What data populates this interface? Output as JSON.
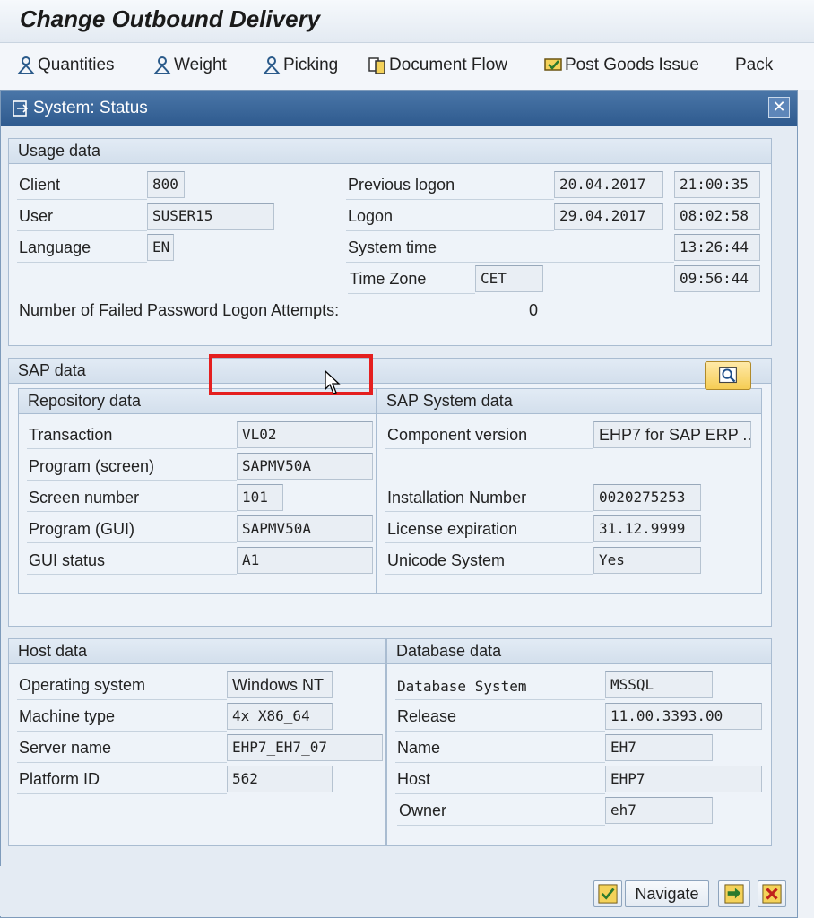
{
  "app": {
    "title": "Change Outbound Delivery"
  },
  "toolbar": {
    "quantities": "Quantities",
    "weight": "Weight",
    "picking": "Picking",
    "document_flow": "Document Flow",
    "post_goods_issue": "Post Goods Issue",
    "pack": "Pack"
  },
  "dialog": {
    "title": "System: Status",
    "close": "✕"
  },
  "usage": {
    "header": "Usage data",
    "client_label": "Client",
    "client": "800",
    "user_label": "User",
    "user": "SUSER15",
    "language_label": "Language",
    "language": "EN",
    "prev_logon_label": "Previous logon",
    "prev_logon_date": "20.04.2017",
    "prev_logon_time": "21:00:35",
    "logon_label": "Logon",
    "logon_date": "29.04.2017",
    "logon_time": "08:02:58",
    "system_time_label": "System time",
    "system_time": "13:26:44",
    "time_zone_label": "Time Zone",
    "time_zone": "CET",
    "time_zone_time": "09:56:44",
    "failed_label": "Number of Failed Password Logon Attempts:",
    "failed": "0"
  },
  "sap": {
    "header": "SAP data",
    "repo_header": "Repository data",
    "transaction_label": "Transaction",
    "transaction": "VL02",
    "program_screen_label": "Program (screen)",
    "program_screen": "SAPMV50A",
    "screen_number_label": "Screen number",
    "screen_number": "101",
    "program_gui_label": "Program (GUI)",
    "program_gui": "SAPMV50A",
    "gui_status_label": "GUI status",
    "gui_status": "A1",
    "system_header": "SAP System data",
    "component_label": "Component version",
    "component": "EHP7 for SAP ERP ...",
    "installation_label": "Installation Number",
    "installation": "0020275253",
    "license_label": "License expiration",
    "license": "31.12.9999",
    "unicode_label": "Unicode System",
    "unicode": "Yes"
  },
  "host": {
    "header": "Host data",
    "os_label": "Operating system",
    "os": "Windows NT",
    "machine_label": "Machine type",
    "machine": "4x X86_64",
    "server_label": "Server name",
    "server": "EHP7_EH7_07",
    "platform_label": "Platform ID",
    "platform": "562"
  },
  "db": {
    "header": "Database data",
    "system_label": "Database System",
    "system": "MSSQL",
    "release_label": "Release",
    "release": "11.00.3393.00",
    "name_label": "Name",
    "name": "EH7",
    "host_label": "Host",
    "host": "EHP7",
    "owner_label": "Owner",
    "owner": "eh7"
  },
  "buttons": {
    "navigate": "Navigate"
  },
  "colors": {
    "highlight": "#e41f1f",
    "titlebar": "#2e5a8e"
  }
}
